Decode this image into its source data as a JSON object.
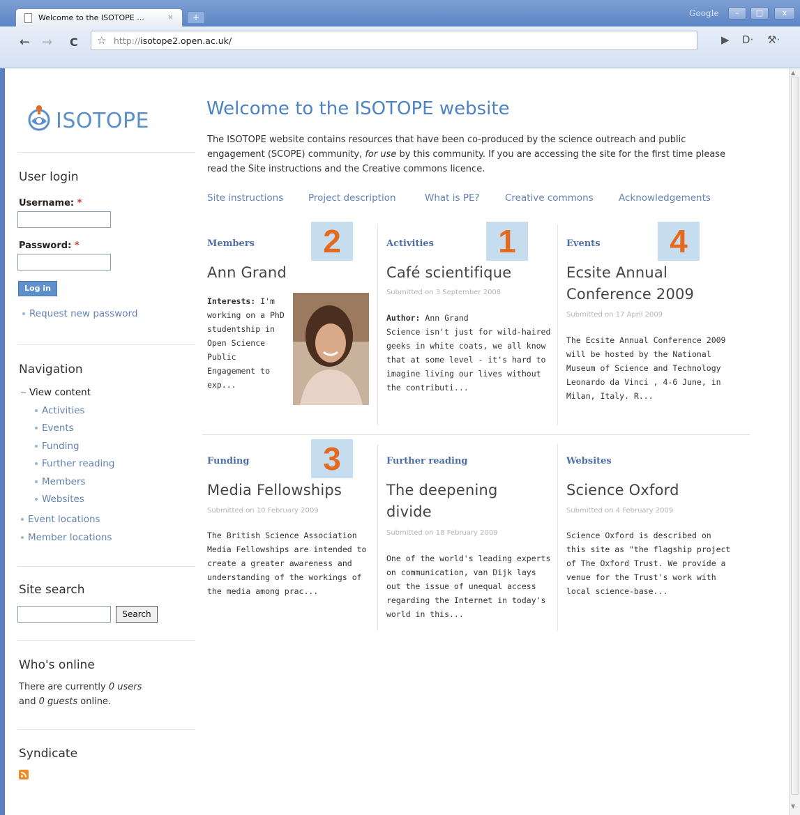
{
  "browser": {
    "tab_title": "Welcome to the ISOTOPE ...",
    "tab_close": "×",
    "new_tab": "+",
    "brand": "Google",
    "window_buttons": {
      "minimize": "–",
      "maximize": "□",
      "close": "x"
    },
    "back": "←",
    "forward": "→",
    "reload": "C",
    "star": "☆",
    "url_protocol": "http://",
    "url_host": "isotope2.open.ac.uk/",
    "page_menu": "▶",
    "doc_menu": "D·",
    "wrench_menu": "⚒·"
  },
  "sidebar": {
    "logo_text": "ISOTOPE",
    "login": {
      "title": "User login",
      "username_label": "Username:",
      "password_label": "Password:",
      "required_mark": "*",
      "username_value": "",
      "password_value": "",
      "button": "Log in",
      "request_password": "Request new password"
    },
    "navigation": {
      "title": "Navigation",
      "view_content": "View content",
      "items": [
        "Activities",
        "Events",
        "Funding",
        "Further reading",
        "Members",
        "Websites"
      ],
      "event_locations": "Event locations",
      "member_locations": "Member locations"
    },
    "search": {
      "title": "Site search",
      "value": "",
      "button": "Search"
    },
    "online": {
      "title": "Who's online",
      "line1": "There are currently ",
      "users": "0 users",
      "line2": "and ",
      "guests": "0 guests",
      "line3": " online."
    },
    "syndicate": {
      "title": "Syndicate",
      "icon": "rss-icon"
    }
  },
  "main": {
    "title": "Welcome to the ISOTOPE website",
    "intro_part1": "The ISOTOPE website contains resources that have been co-produced by the science outreach and public engagement (SCOPE) community, ",
    "intro_em": "for use",
    "intro_part2": " by this community. If you are accessing the site for the first time please read the Site instructions and the Creative commons licence.",
    "menu": [
      "Site instructions",
      "Project description",
      "What is PE?",
      "Creative commons",
      "Acknowledgements"
    ],
    "blocks": [
      {
        "category": "Members",
        "number": "2",
        "title": "Ann Grand",
        "interests_label": "Interests:",
        "body": "I'm working on a PhD studentship in Open Science Public Engagement to exp..."
      },
      {
        "category": "Activities",
        "number": "1",
        "title": "Café scientifique",
        "submitted": "Submitted on 3 September 2008",
        "author_label": "Author:",
        "author": "Ann Grand",
        "body": "Science isn't just for wild-haired geeks in white coats, we all know that at some level - it's hard to imagine living our lives without the contributi..."
      },
      {
        "category": "Events",
        "number": "4",
        "title": "Ecsite Annual Conference 2009",
        "submitted": "Submitted on 17 April 2009",
        "body": "The Ecsite Annual Conference 2009 will be hosted by the National Museum of Science and Technology Leonardo da Vinci , 4-6 June, in Milan, Italy. R..."
      },
      {
        "category": "Funding",
        "number": "3",
        "title": "Media Fellowships",
        "submitted": "Submitted on 10 February 2009",
        "body": "The British Science Association Media Fellowships are intended to create a greater awareness and understanding of the workings of the media among prac..."
      },
      {
        "category": "Further reading",
        "title": "The deepening divide",
        "submitted": "Submitted on 18 February 2009",
        "body": "One of the world's leading experts on communication, van Dijk lays out the issue of unequal access regarding the Internet in today's world in this..."
      },
      {
        "category": "Websites",
        "title": "Science Oxford",
        "submitted": "Submitted on 4 February 2009",
        "body": "Science Oxford is described on this site as \"the flagship project of The Oxford Trust. We provide a venue for the Trust's work with local science-base..."
      }
    ]
  },
  "colors": {
    "accent": "#4d82c3",
    "link": "#6483b5",
    "number": "#e36a1e",
    "number_bg": "#c6dcef",
    "chrome": "#5c85c6"
  }
}
